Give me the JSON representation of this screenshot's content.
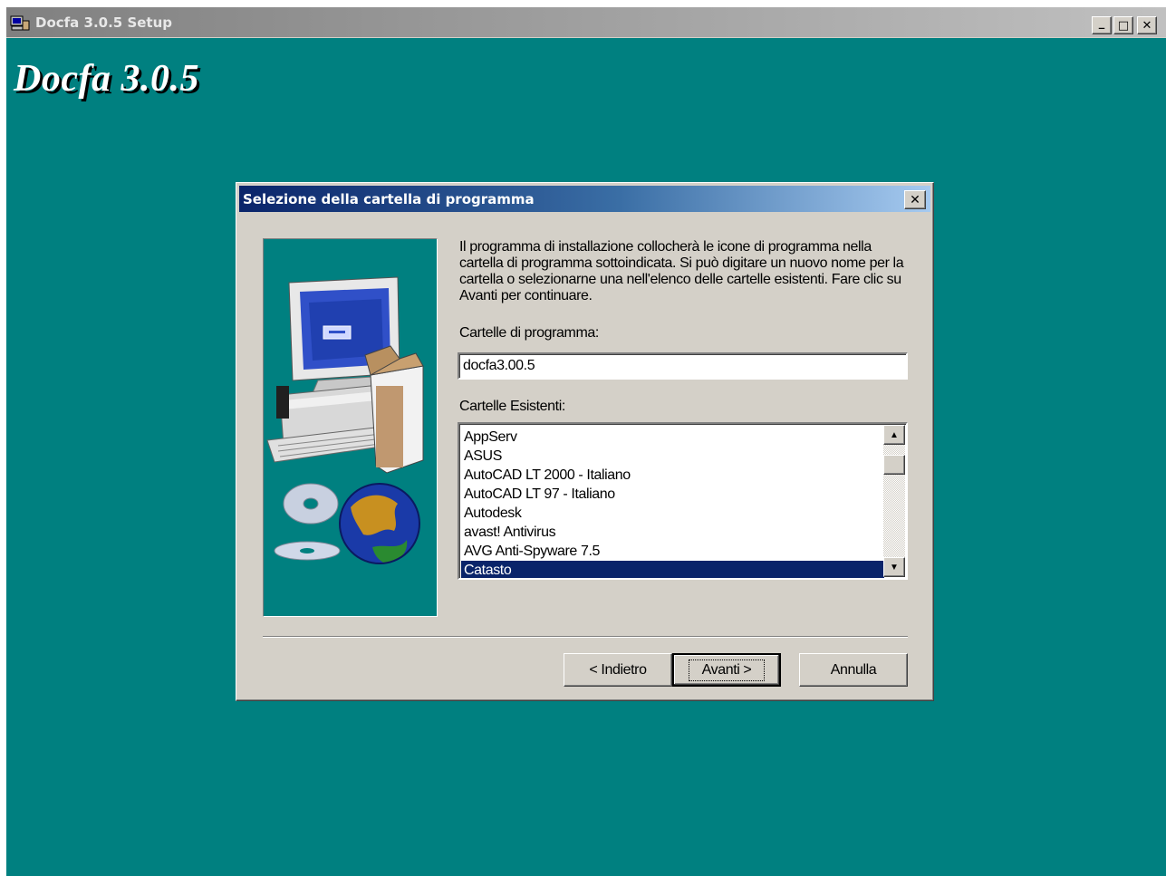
{
  "outer_window": {
    "title": "Docfa 3.0.5 Setup",
    "minimize_glyph": "_",
    "maximize_glyph": "□",
    "close_glyph": "✕",
    "heading": "Docfa 3.0.5"
  },
  "dialog": {
    "title": "Selezione della cartella di programma",
    "close_glyph": "✕",
    "description": "Il programma di installazione collocherà le icone di programma nella cartella di programma sottoindicata. Si può digitare un nuovo nome per la cartella o selezionarne una nell'elenco delle cartelle esistenti. Fare clic su Avanti per continuare.",
    "program_folder_label": "Cartelle di programma:",
    "program_folder_value": "docfa3.00.5",
    "existing_folders_label": "Cartelle Esistenti:",
    "existing_folders": [
      "AppServ",
      "ASUS",
      "AutoCAD LT 2000 - Italiano",
      "AutoCAD LT 97 - Italiano",
      "Autodesk",
      "avast! Antivirus",
      "AVG Anti-Spyware 7.5",
      "Catasto"
    ],
    "selected_folder": "Catasto",
    "scroll_up_glyph": "▲",
    "scroll_down_glyph": "▼",
    "buttons": {
      "back": "< Indietro",
      "next": "Avanti >",
      "cancel": "Annulla"
    }
  },
  "colors": {
    "desktop_teal": "#008080",
    "selection": "#0a246a",
    "face": "#d4d0c8"
  }
}
